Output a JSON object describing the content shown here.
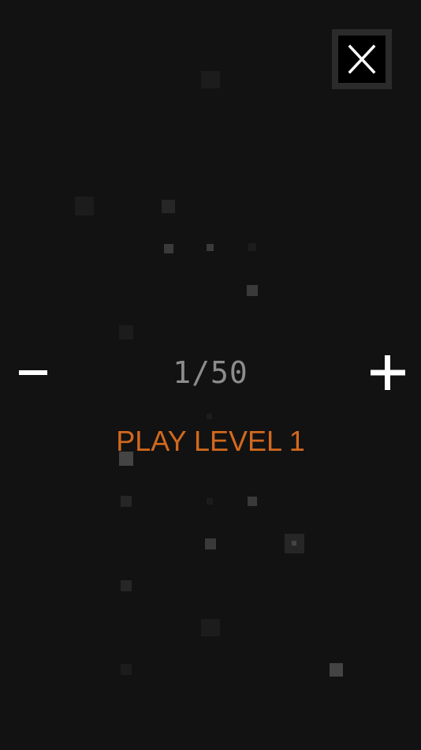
{
  "level": {
    "counter_text": "1/50",
    "current": 1,
    "total": 50
  },
  "play_label": "PLAY LEVEL 1",
  "controls": {
    "close_label": "X",
    "close_icon": "close-icon",
    "decrement_icon": "minus-icon",
    "increment_icon": "plus-icon"
  },
  "colors": {
    "background": "#121212",
    "accent": "#d2691e",
    "counter_text": "#8c8c8c",
    "icon": "#ffffff"
  }
}
